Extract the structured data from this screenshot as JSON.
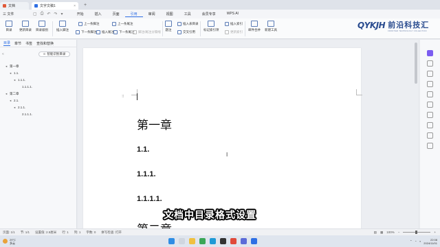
{
  "titlebar": {
    "tabs": [
      {
        "label": "文档",
        "active": false
      },
      {
        "label": "文字文稿1",
        "active": true
      }
    ],
    "plus": "+",
    "close": "×"
  },
  "menubar": {
    "file_label": "三 文件",
    "menus": [
      "开始",
      "插入",
      "页面",
      "引用",
      "审阅",
      "视图",
      "工具",
      "会员专享",
      "WPS AI"
    ],
    "active_menu": "引用"
  },
  "ribbon": {
    "toc": "目录",
    "toc_update": "更新目录",
    "toc_level": "目录级别",
    "insert_footnote": "插入脚注",
    "prev_footnote": "上一条脚注",
    "next_footnote": "下一条脚注",
    "insert_endnote": "插入尾注",
    "prev_endnote": "上一条尾注",
    "next_endnote": "下一条尾注",
    "footnote_endnote_sep": "脚注/尾注分隔线",
    "caption": "题注",
    "insert_table_of_figures": "插入表目录",
    "cross_ref": "交叉引用",
    "mark_index": "标记索引项",
    "insert_index": "插入索引",
    "update_index": "更新索引",
    "mail_merge": "邮件合并",
    "citation_tools": "新建工具"
  },
  "logo": {
    "mark": "QYKJH",
    "name": "前沿科技汇",
    "tagline": "FRONTIER TECHNOLOGY COLLECTION"
  },
  "navpane": {
    "tabs": [
      "目录",
      "章节",
      "书签",
      "查找和替换"
    ],
    "active_tab": "目录",
    "smart_button": "智能识别目录",
    "toc_items": [
      {
        "level": 1,
        "label": "第一章",
        "caret": "◂"
      },
      {
        "level": 2,
        "label": "1.1.",
        "caret": "◂"
      },
      {
        "level": 3,
        "label": "1.1.1.",
        "caret": "◂"
      },
      {
        "level": 4,
        "label": "1.1.1.1.",
        "caret": ""
      },
      {
        "level": 1,
        "label": "第二章",
        "caret": "◂"
      },
      {
        "level": 2,
        "label": "2.1.",
        "caret": "◂"
      },
      {
        "level": 3,
        "label": "2.1.1.",
        "caret": "◂"
      },
      {
        "level": 4,
        "label": "2.1.1.1.",
        "caret": ""
      }
    ]
  },
  "document": {
    "headings": [
      {
        "text": "第一章",
        "style": "h1"
      },
      {
        "text": "1.1.",
        "style": "h"
      },
      {
        "text": "1.1.1.",
        "style": "h"
      },
      {
        "text": "1.1.1.1.",
        "style": "h"
      },
      {
        "text": "第二章",
        "style": "h1"
      }
    ]
  },
  "subtitle": "文档中目录格式设置",
  "statusbar": {
    "page": "页面: 1/1",
    "section": "节: 1/1",
    "position": "设置值: 2.5厘米",
    "row": "行: 1",
    "col": "列: 1",
    "words": "字数: 0",
    "spell": "拼写检查: 打开",
    "zoom": "100%"
  },
  "taskbar": {
    "weather_temp": "29°C",
    "weather_desc": "多云",
    "time": "22:08",
    "date": "2024/11/01"
  },
  "colors": {
    "accent": "#2f6fe4",
    "logo_blue": "#2a4c8f"
  }
}
